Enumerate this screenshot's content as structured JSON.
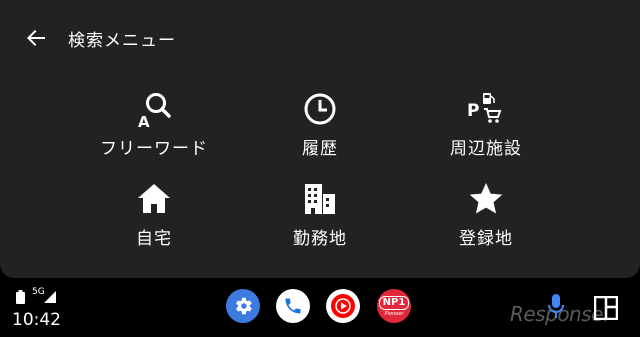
{
  "header": {
    "title": "検索メニュー"
  },
  "menu": [
    {
      "label": "フリーワード",
      "icon": "search-a-icon"
    },
    {
      "label": "履歴",
      "icon": "clock-icon"
    },
    {
      "label": "周辺施設",
      "icon": "parking-fuel-shopping-icon"
    },
    {
      "label": "自宅",
      "icon": "home-icon"
    },
    {
      "label": "勤務地",
      "icon": "office-building-icon"
    },
    {
      "label": "登録地",
      "icon": "star-icon"
    }
  ],
  "status": {
    "time": "10:42",
    "network": "5G"
  },
  "dock": [
    {
      "name": "settings",
      "color": "#3d7be0"
    },
    {
      "name": "phone",
      "color": "#ffffff"
    },
    {
      "name": "youtube-music",
      "color": "#ffffff"
    },
    {
      "name": "npi-pioneer",
      "color": "#e0283a",
      "text": "NP1",
      "sub": "Pioneer"
    }
  ],
  "watermark": "Response."
}
